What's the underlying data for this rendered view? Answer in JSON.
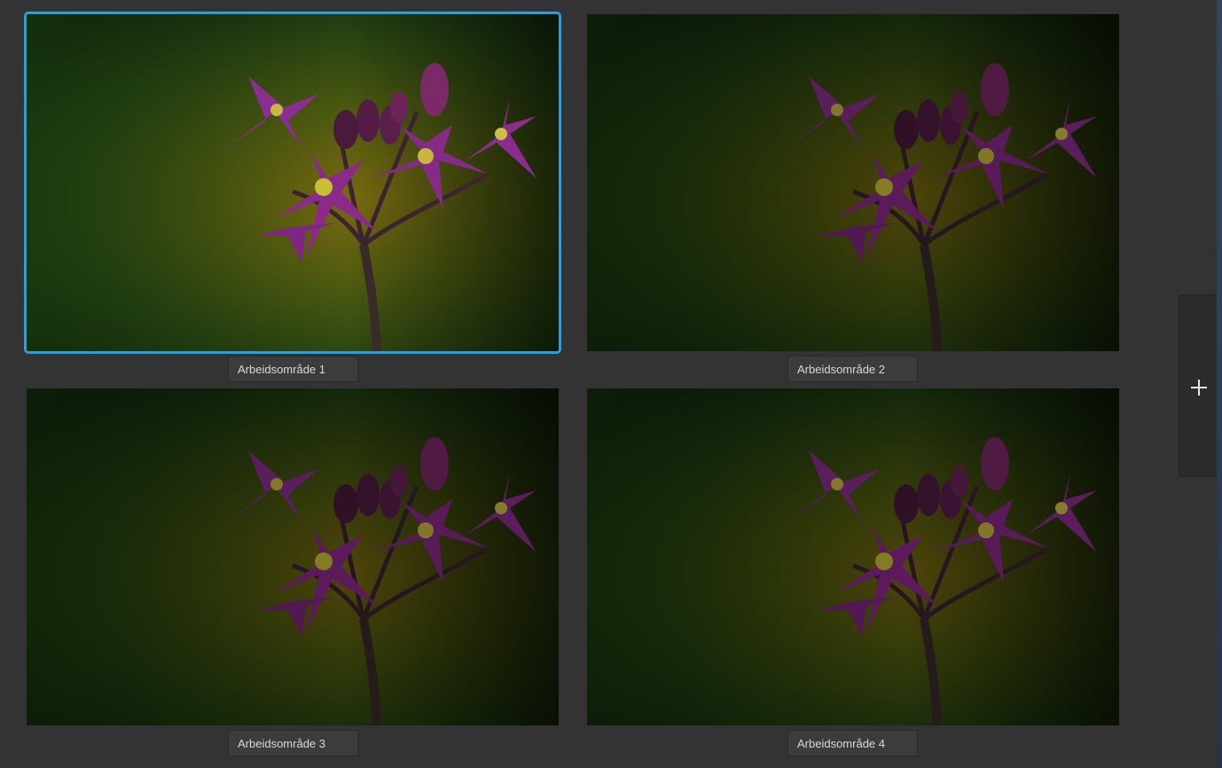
{
  "artboards": [
    {
      "label": "Arbeidsområde 1",
      "selected": true
    },
    {
      "label": "Arbeidsområde 2",
      "selected": false
    },
    {
      "label": "Arbeidsområde 3",
      "selected": false
    },
    {
      "label": "Arbeidsområde 4",
      "selected": false
    }
  ],
  "add_panel": {
    "icon": "plus-icon"
  },
  "colors": {
    "background": "#333333",
    "selection_accent": "#2a9fe0",
    "label_bg": "#3c3c3c",
    "label_text": "#d8d8d8",
    "add_panel_bg": "#2b2b2b"
  }
}
